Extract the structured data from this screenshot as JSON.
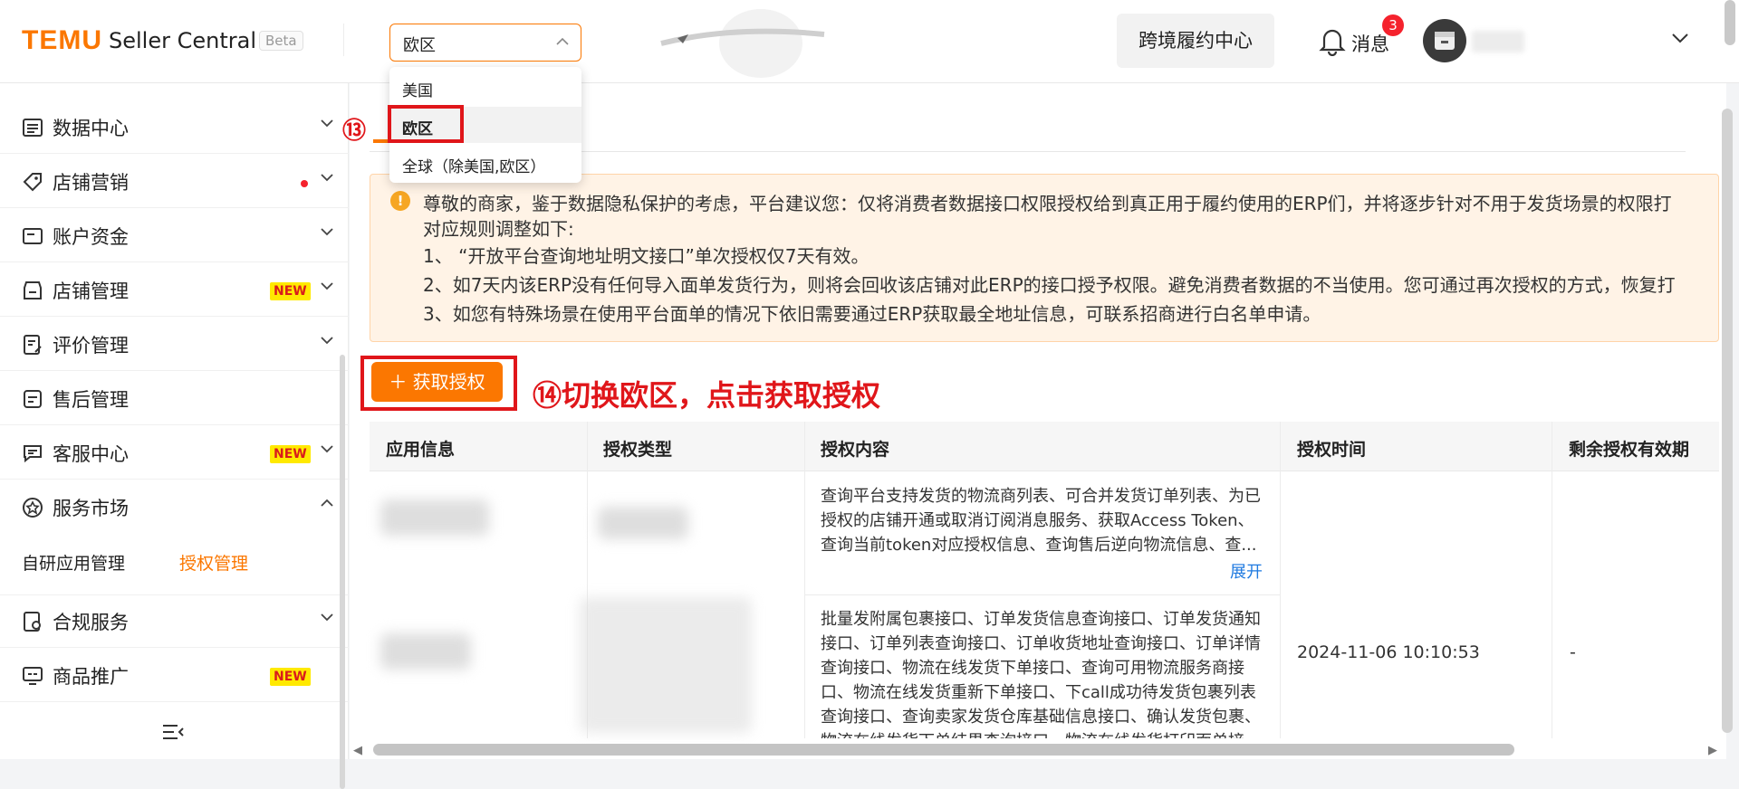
{
  "header": {
    "logo": "TEMU",
    "app_name": "Seller Central",
    "beta": "Beta",
    "region_value": "欧区",
    "cross_border_button": "跨境履约中心",
    "messages_label": "消息",
    "messages_count": "3"
  },
  "region_dropdown": {
    "options": [
      "美国",
      "欧区",
      "全球（除美国,欧区）"
    ],
    "selected": "欧区"
  },
  "sidebar": {
    "items": [
      {
        "label": "数据中心",
        "icon": "chart-list-icon"
      },
      {
        "label": "店铺营销",
        "icon": "tag-icon",
        "dot": true
      },
      {
        "label": "账户资金",
        "icon": "wallet-icon"
      },
      {
        "label": "店铺管理",
        "icon": "store-icon",
        "badge": "NEW"
      },
      {
        "label": "评价管理",
        "icon": "review-icon"
      },
      {
        "label": "售后管理",
        "icon": "aftersale-icon"
      },
      {
        "label": "客服中心",
        "icon": "chat-icon",
        "badge": "NEW"
      },
      {
        "label": "服务市场",
        "icon": "service-market-icon",
        "expanded": true
      },
      {
        "label": "合规服务",
        "icon": "compliance-icon"
      },
      {
        "label": "商品推广",
        "icon": "promote-icon",
        "badge": "NEW"
      }
    ],
    "sub_items": [
      "自研应用管理",
      "授权管理"
    ],
    "active_sub_item": "授权管理"
  },
  "annotations": {
    "step13": "⑬",
    "step14": "⑭切换欧区，点击获取授权"
  },
  "notice": {
    "lines": [
      "尊敬的商家，鉴于数据隐私保护的考虑，平台建议您：仅将消费者数据接口权限授权给到真正用于履约使用的ERP们，并将逐步针对不用于发货场景的权限打",
      "对应规则调整如下:",
      "1、 “开放平台查询地址明文接口”单次授权仅7天有效。",
      "2、如7天内该ERP没有任何导入面单发货行为，则将会回收该店铺对此ERP的接口授予权限。避免消费者数据的不当使用。您可通过再次授权的方式，恢复打",
      "3、如您有特殊场景在使用平台面单的情况下依旧需要通过ERP获取最全地址信息，可联系招商进行白名单申请。"
    ]
  },
  "auth_button": "＋ 获取授权",
  "table": {
    "columns": [
      "应用信息",
      "授权类型",
      "授权内容",
      "授权时间",
      "剩余授权有效期"
    ],
    "row1_content": [
      "查询平台支持发货的物流商列表、可合并发货订单列表、为已",
      "授权的店铺开通或取消订阅消息服务、获取Access Token、",
      "查询当前token对应授权信息、查询售后逆向物流信息、查..."
    ],
    "expand_label": "展开",
    "row2_content": [
      "批量发附属包裹接口、订单发货信息查询接口、订单发货通知",
      "接口、订单列表查询接口、订单收货地址查询接口、订单详情",
      "查询接口、物流在线发货下单接口、查询可用物流服务商接",
      "口、物流在线发货重新下单接口、下call成功待发货包裹列表",
      "查询接口、查询卖家发货仓库基础信息接口、确认发货包裹、",
      "物流在线发货下单结果查询接口、物流在线发货打印面单接..."
    ],
    "auth_time": "2024-11-06 10:10:53",
    "remaining": "-"
  },
  "colors": {
    "brand": "#fb7701",
    "annotation_red": "#e0161a"
  }
}
